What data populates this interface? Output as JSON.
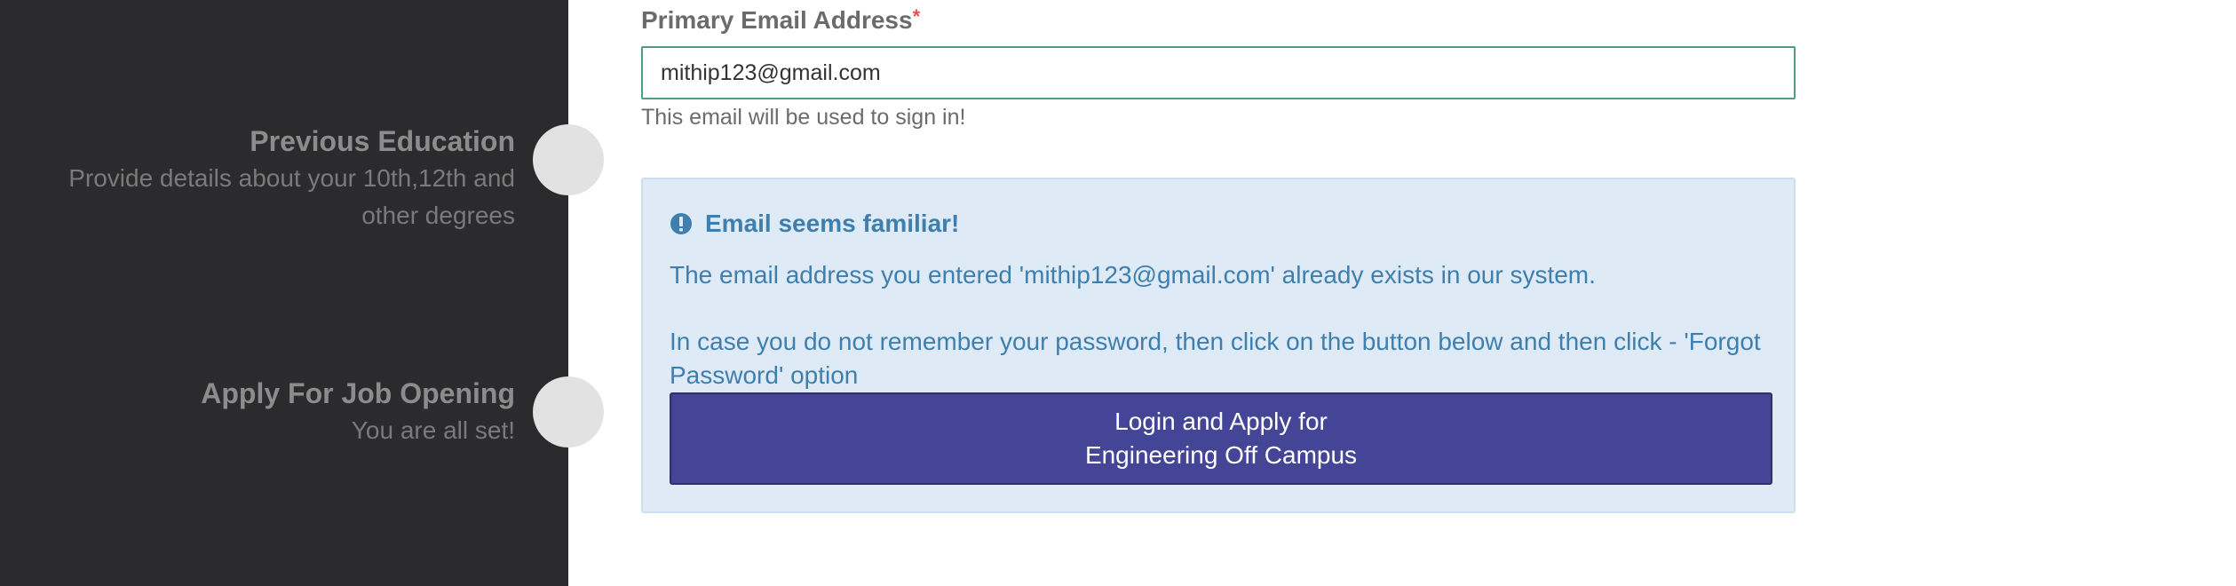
{
  "sidebar": {
    "steps": [
      {
        "title": "Previous Education",
        "description_line1": "Provide details about your 10th,12th and",
        "description_line2": "other degrees"
      },
      {
        "title": "Apply For Job Opening",
        "description_line1": "You are all set!"
      }
    ]
  },
  "form": {
    "email_label": "Primary Email Address",
    "required_marker": "*",
    "email_value": "mithip123@gmail.com",
    "email_help": "This email will be used to sign in!"
  },
  "alert": {
    "icon": "exclamation-circle-icon",
    "title": "Email seems familiar!",
    "message": "The email address you entered 'mithip123@gmail.com' already exists in our system.",
    "instruction": "In case you do not remember your password, then click on the button below and then click - 'Forgot Password' option",
    "button_line1": "Login and Apply for",
    "button_line2": "Engineering Off Campus"
  },
  "colors": {
    "sidebar_bg": "#2b2b2e",
    "input_border": "#4f9e86",
    "alert_bg": "#deebf6",
    "alert_text": "#3f7fae",
    "button_bg": "#454597",
    "required_star": "#e05252"
  }
}
